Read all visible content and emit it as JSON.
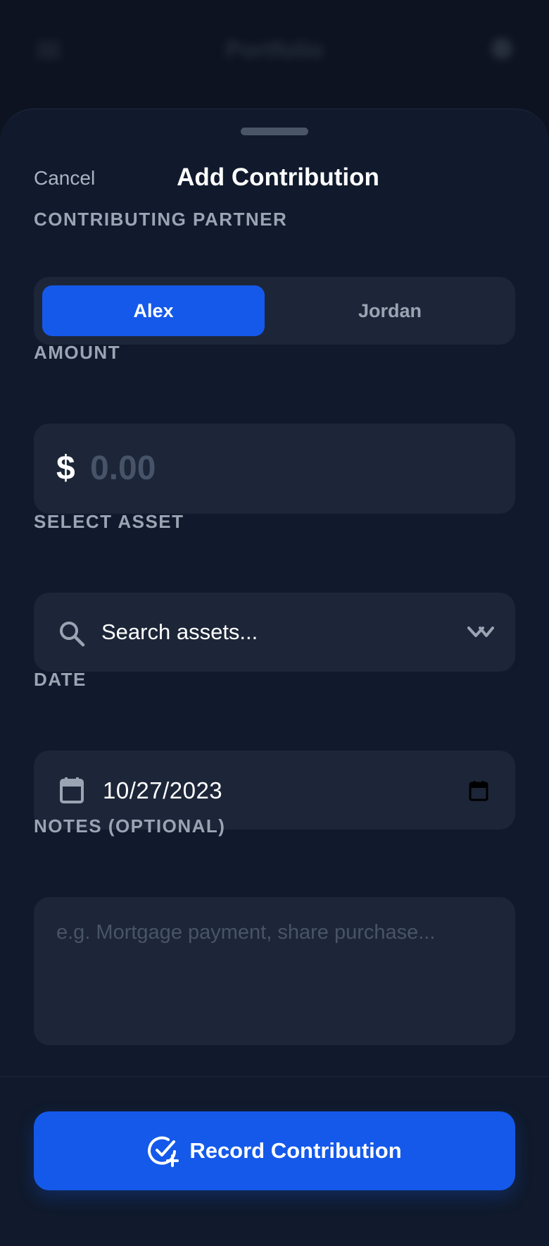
{
  "background": {
    "title": "Portfolio"
  },
  "sheet": {
    "cancel_label": "Cancel",
    "title": "Add Contribution"
  },
  "partner": {
    "label": "CONTRIBUTING PARTNER",
    "options": [
      "Alex",
      "Jordan"
    ],
    "selected": "Alex"
  },
  "amount": {
    "label": "AMOUNT",
    "currency_symbol": "$",
    "placeholder": "0.00",
    "value": ""
  },
  "asset": {
    "label": "SELECT ASSET",
    "placeholder": "Search assets...",
    "search_icon": "search-icon",
    "dropdown_icon": "chevron-down-icon"
  },
  "date": {
    "label": "DATE",
    "value": "10/27/2023",
    "icon": "calendar-icon"
  },
  "notes": {
    "label": "NOTES (OPTIONAL)",
    "placeholder": "e.g. Mortgage payment, share purchase...",
    "value": ""
  },
  "submit": {
    "label": "Record Contribution",
    "icon": "check-circle-plus-icon"
  },
  "colors": {
    "accent": "#1459ea",
    "sheet_bg": "#101a2c",
    "field_bg": "#1d2638",
    "label_text": "#9aa4b3"
  }
}
